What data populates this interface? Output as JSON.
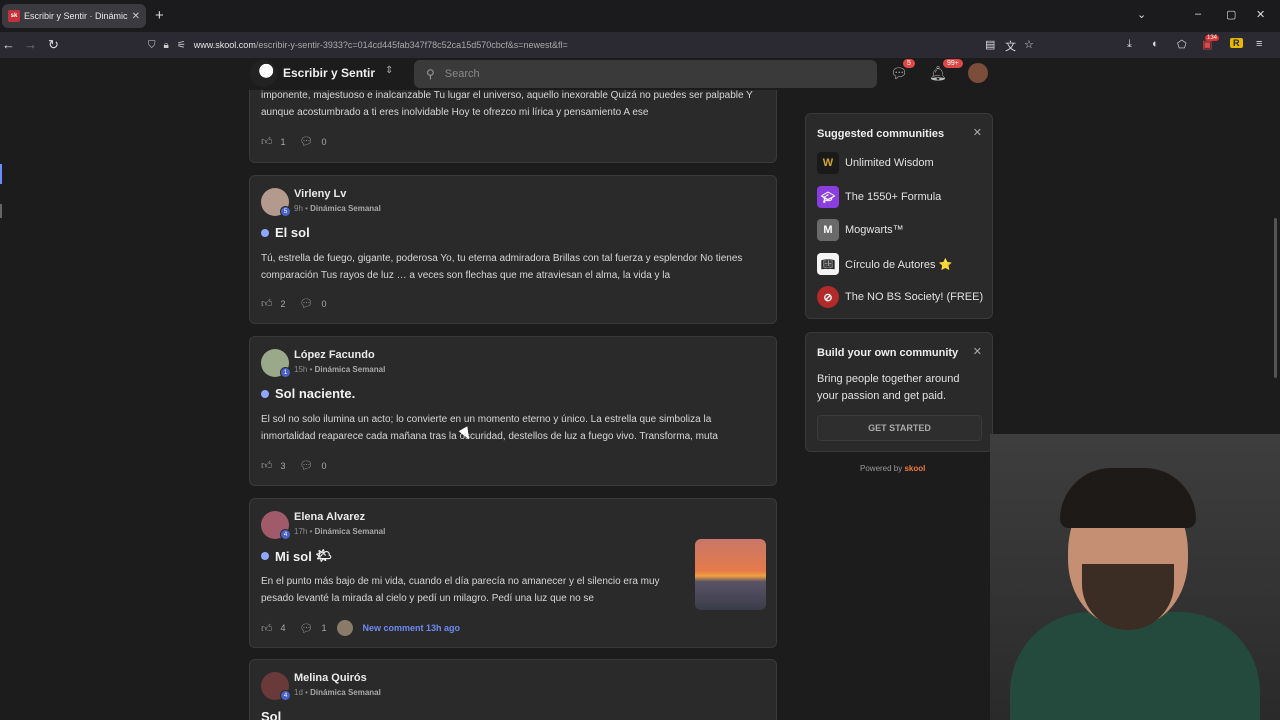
{
  "browser": {
    "tab_title": "Escribir y Sentir · Dinámica Sem",
    "favicon_text": "sk",
    "url_host": "www.skool.com",
    "url_path": "/escribir-y-sentir-3933?c=014cd445fab347f78c52ca15d570cbcf&s=newest&fl=",
    "ext_badge": "134",
    "ext_letter": "R"
  },
  "header": {
    "community_name": "Escribir y Sentir",
    "search_placeholder": "Search",
    "chat_badge": "5",
    "notif_badge": "99+"
  },
  "posts": [
    {
      "body": "imponente, majestuoso e inalcanzable Tu lugar el universo, aquello inexorable Quizá no puedes ser palpable Y aunque acostumbrado a ti eres inolvidable Hoy te ofrezco mi lírica y pensamiento A ese",
      "likes": "1",
      "comments": "0"
    },
    {
      "author": "Virleny Lv",
      "level": "5",
      "time": "9h",
      "category": "Dinámica Semanal",
      "title": "El sol",
      "body": "Tú, estrella de fuego, gigante, poderosa Yo, tu eterna admiradora Brillas con tal fuerza y esplendor No tienes comparación Tus rayos de luz … a veces son flechas que me atraviesan el alma, la vida y la",
      "likes": "2",
      "comments": "0"
    },
    {
      "author": "López Facundo",
      "level": "1",
      "time": "15h",
      "category": "Dinámica Semanal",
      "title": "Sol naciente.",
      "body": "El sol no solo ilumina un acto; lo convierte en un momento eterno y único. La estrella que simboliza la inmortalidad reaparece cada mañana tras la oscuridad, destellos de luz a fuego vivo. Transforma, muta",
      "likes": "3",
      "comments": "0"
    },
    {
      "author": "Elena Alvarez",
      "level": "4",
      "time": "17h",
      "category": "Dinámica Semanal",
      "title": "Mi sol",
      "title_emoji": "🌤",
      "body": "En el punto más bajo de mi vida, cuando el día parecía no amanecer y el silencio era muy pesado levanté la mirada al cielo y pedí un milagro. Pedí una luz que no se",
      "likes": "4",
      "comments": "1",
      "new_comment": "New comment 13h ago"
    },
    {
      "author": "Melina Quirós",
      "level": "4",
      "time": "1d",
      "category": "Dinámica Semanal",
      "title": "Sol"
    }
  ],
  "suggested": {
    "title": "Suggested communities",
    "items": [
      {
        "name": "Unlimited Wisdom",
        "icon": "wisdom-icon",
        "color": "#1a1a1a"
      },
      {
        "name": "The 1550+ Formula",
        "icon": "graduation-cap-icon",
        "color": "#8a3ee0"
      },
      {
        "name": "Mogwarts™",
        "icon": "m-logo-icon",
        "color": "#6a6a6a"
      },
      {
        "name": "Círculo de Autores ⭐",
        "icon": "book-icon",
        "color": "#f4f4f4"
      },
      {
        "name": "The NO BS Society! (FREE)",
        "icon": "no-sign-icon",
        "color": "#b22a2a"
      }
    ]
  },
  "build": {
    "title": "Build your own community",
    "text": "Bring people together around your passion and get paid.",
    "button": "GET STARTED"
  },
  "powered_by": "Powered by",
  "powered_brand": "skool"
}
